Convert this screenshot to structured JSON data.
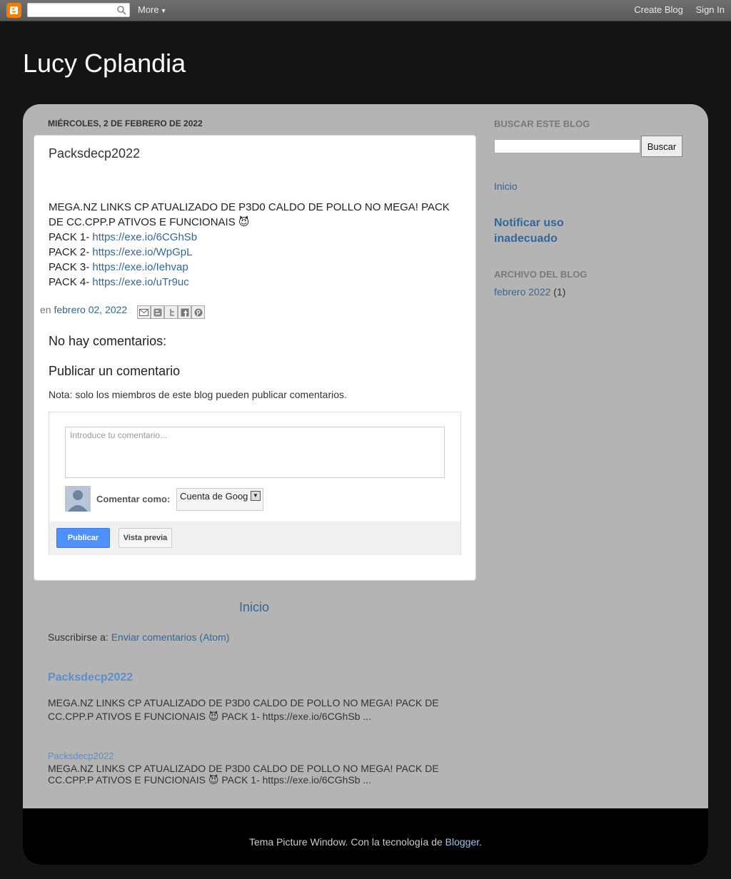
{
  "navbar": {
    "search_placeholder": "",
    "more": "More",
    "create_blog": "Create Blog",
    "sign_in": "Sign In"
  },
  "header": {
    "title": "Lucy Cplandia"
  },
  "post": {
    "date": "miércoles, 2 de febrero de 2022",
    "title": "Packsdecp2022",
    "body_line1": "MEGA.NZ LINKS CP ATUALIZADO DE P3D0 CALDO DE POLLO  NO MEGA! PACK",
    "body_line2": "DE CC.CPP.P ATIVOS E FUNCIONAIS 😈",
    "packs": [
      {
        "label": "PACK 1- ",
        "url": "https://exe.io/6CGhSb"
      },
      {
        "label": "PACK 2- ",
        "url": "https://exe.io/WpGpL"
      },
      {
        "label": "PACK 3- ",
        "url": "https://exe.io/Iehvap"
      },
      {
        "label": "PACK 4- ",
        "url": "https://exe.io/uTr9uc"
      }
    ],
    "footer_prefix": "en ",
    "footer_date": "febrero 02, 2022"
  },
  "comments": {
    "title": "No hay comentarios:",
    "publish_title": "Publicar un comentario",
    "note": "Nota: solo los miembros de este blog pueden publicar comentarios.",
    "placeholder": "Introduce tu comentario...",
    "comment_as": "Comentar como:",
    "account": "Cuenta de Goog",
    "publish_button": "Publicar",
    "preview_button": "Vista previa"
  },
  "nav": {
    "home": "Inicio"
  },
  "subscribe": {
    "prefix": "Suscribirse a: ",
    "link": "Enviar comentarios (Atom)"
  },
  "popular_post": {
    "title": "Packsdecp2022",
    "snippet": "  MEGA.NZ LINKS CP ATUALIZADO DE P3D0 CALDO DE POLLO  NO MEGA! PACK DE CC.CPP.P ATIVOS E FUNCIONAIS 😈    PACK 1- https://exe.io/6CGhSb ..."
  },
  "featured_post": {
    "title": "Packsdecp2022",
    "snippet": "  MEGA.NZ LINKS CP ATUALIZADO DE P3D0 CALDO DE POLLO  NO MEGA! PACK DE CC.CPP.P ATIVOS E FUNCIONAIS 😈    PACK 1- https://exe.io/6CGhSb ..."
  },
  "sidebar": {
    "search_title": "Buscar este blog",
    "search_button": "Buscar",
    "home_link": "Inicio",
    "report": "Notificar uso inadecuado",
    "archive_title": "Archivo del blog",
    "archive_link": "febrero 2022",
    "archive_count": " (1)"
  },
  "footer": {
    "text": "Tema Picture Window. Con la tecnología de ",
    "link": "Blogger",
    "end": "."
  },
  "colors": {
    "page_bg": "#141414",
    "content_bg": "#b4b4b4",
    "link": "#336699",
    "brand": "#f57d00",
    "publish_button": "#4d90fe"
  },
  "icons": [
    "blogger-logo-icon",
    "search-icon",
    "email-icon",
    "blogthis-icon",
    "twitter-icon",
    "facebook-icon",
    "pinterest-icon",
    "avatar-icon",
    "dropdown-arrow-icon"
  ]
}
